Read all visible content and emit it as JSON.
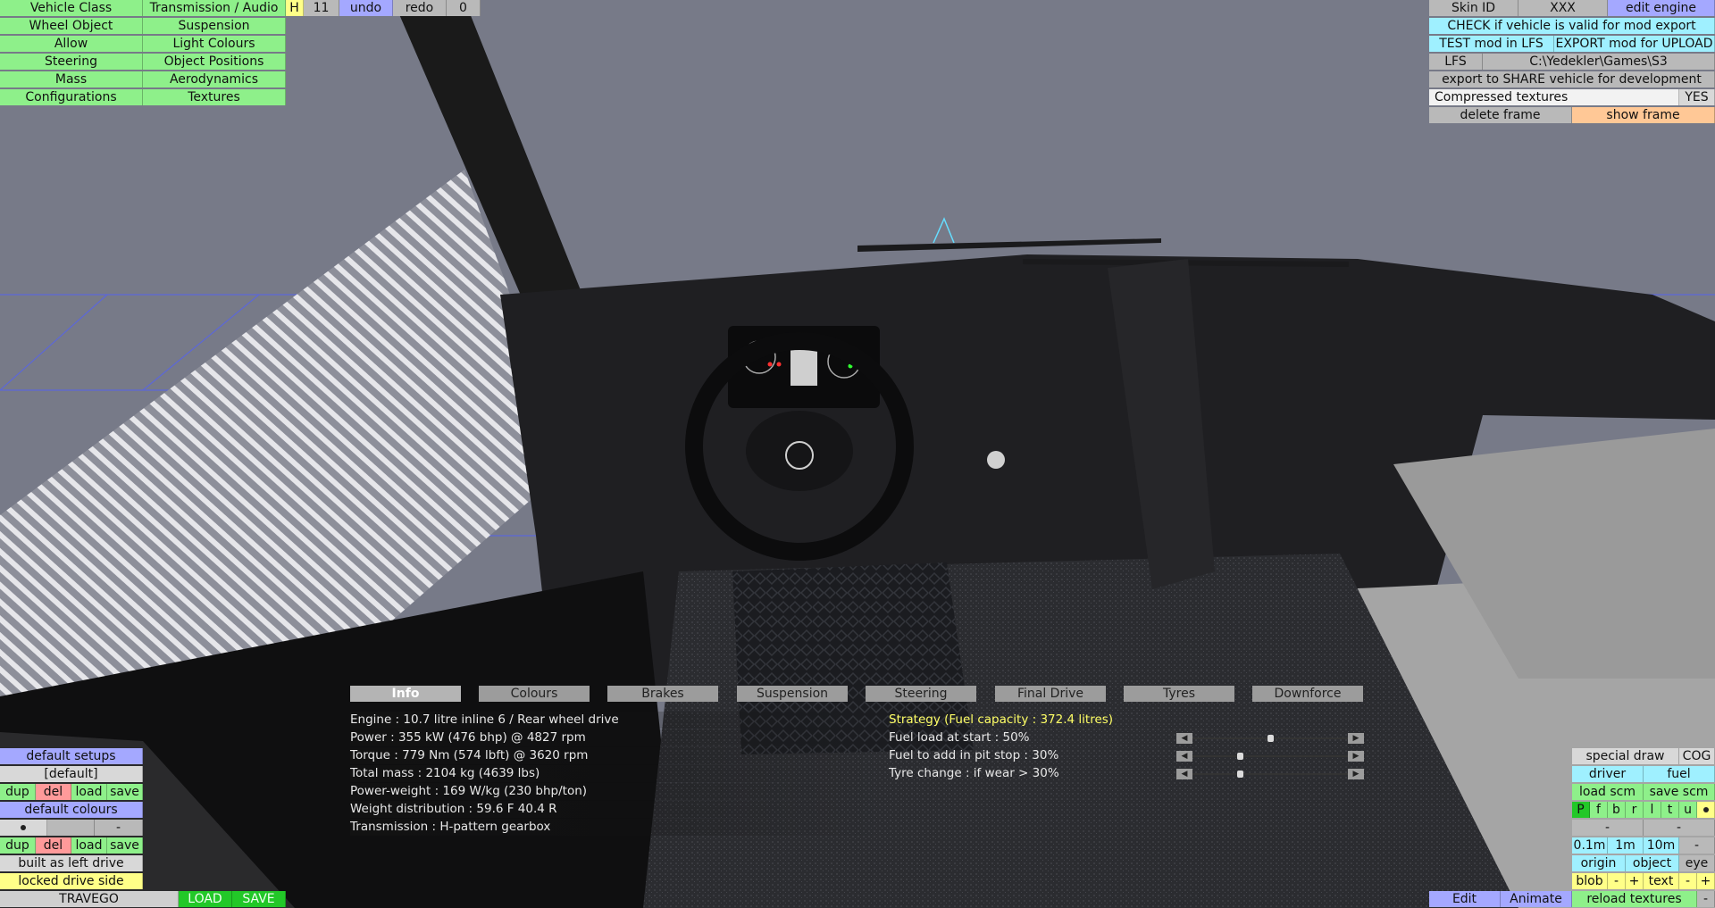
{
  "top_menu": {
    "col1": [
      "Vehicle Class",
      "Wheel Object",
      "Allow",
      "Steering",
      "Mass",
      "Configurations"
    ],
    "col2": [
      "Transmission / Audio",
      "Suspension",
      "Light Colours",
      "Object Positions",
      "Aerodynamics",
      "Textures"
    ],
    "h_label": "H",
    "number": "11",
    "undo": "undo",
    "redo": "redo",
    "zero": "0"
  },
  "top_right": {
    "skin_id_label": "Skin ID",
    "skin_id_value": "XXX",
    "edit_engine": "edit engine",
    "check": "CHECK if vehicle is valid for mod export",
    "test": "TEST mod in LFS",
    "export": "EXPORT mod for UPLOAD",
    "lfs_label": "LFS",
    "lfs_path": "C:\\Yedekler\\Games\\S3",
    "share": "export to SHARE vehicle for development",
    "compressed": "Compressed textures",
    "compressed_value": "YES",
    "delete_frame": "delete frame",
    "show_frame": "show frame"
  },
  "tabs": [
    "Info",
    "Colours",
    "Brakes",
    "Suspension",
    "Steering",
    "Final Drive",
    "Tyres",
    "Downforce"
  ],
  "active_tab": "Info",
  "info_lines": [
    "Engine : 10.7 litre inline 6 / Rear wheel drive",
    "Power : 355 kW (476 bhp) @ 4827 rpm",
    "Torque : 779 Nm (574 lbft) @ 3620 rpm",
    "Total mass : 2104 kg (4639 lbs)",
    "Power-weight : 169 W/kg (230 bhp/ton)",
    "Weight distribution : 59.6 F  40.4 R",
    "Transmission : H-pattern gearbox"
  ],
  "strategy": {
    "title": "Strategy (Fuel capacity : 372.4 litres)",
    "rows": [
      {
        "label": "Fuel load at start : 50%",
        "value": 0.5
      },
      {
        "label": "Fuel to add in pit stop : 30%",
        "value": 0.3
      },
      {
        "label": "Tyre change : if wear > 30%",
        "value": 0.3
      }
    ]
  },
  "bottom_left": {
    "default_setups": "default setups",
    "default_name": "[default]",
    "dup": "dup",
    "del": "del",
    "load": "load",
    "save": "save",
    "default_colours": "default colours",
    "minus": "-",
    "built_as": "built as left drive",
    "locked": "locked drive side",
    "vehicle_name": "TRAVEGO",
    "LOAD": "LOAD",
    "SAVE": "SAVE"
  },
  "bottom_right": {
    "special_draw": "special draw",
    "cog": "COG",
    "driver": "driver",
    "fuel": "fuel",
    "load_scm": "load scm",
    "save_scm": "save scm",
    "flags": [
      "P",
      "f",
      "b",
      "r",
      "l",
      "t",
      "u"
    ],
    "minus": "-",
    "scale": [
      "0.1m",
      "1m",
      "10m",
      "-"
    ],
    "origin": "origin",
    "object": "object",
    "eye": "eye",
    "blob": "blob",
    "plus": "+",
    "text": "text",
    "edit": "Edit",
    "animate": "Animate",
    "reload": "reload textures"
  }
}
